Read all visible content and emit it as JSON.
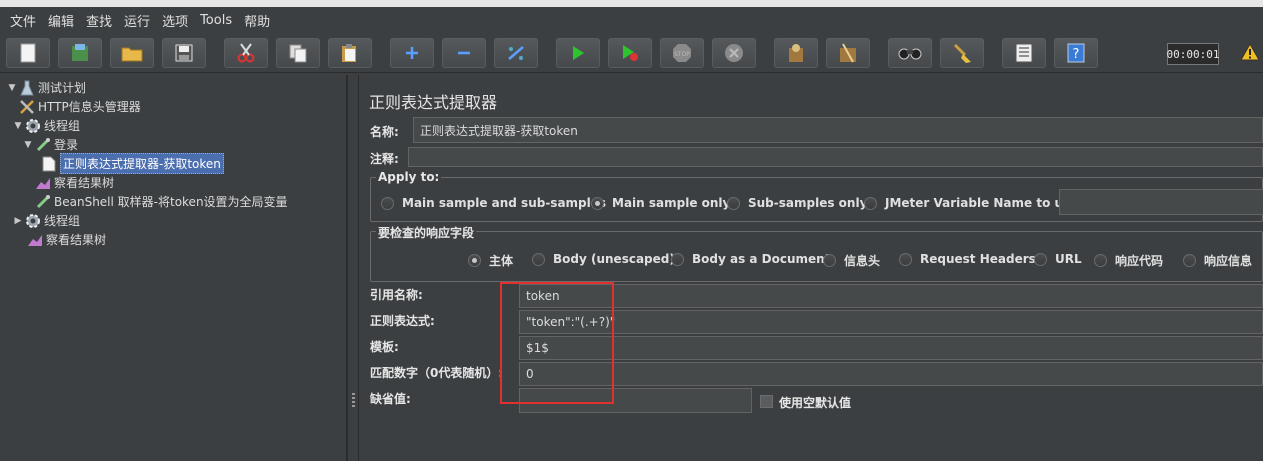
{
  "menu": [
    "文件",
    "编辑",
    "查找",
    "运行",
    "选项",
    "Tools",
    "帮助"
  ],
  "timer": "00:00:01",
  "toolbar_icons": [
    "new-icon",
    "template-icon",
    "open-icon",
    "save-icon",
    "cut-icon",
    "copy-icon",
    "paste-icon",
    "expand-icon",
    "collapse-icon",
    "toggle-icon",
    "start-icon",
    "start-no-pause-icon",
    "stop-icon",
    "shutdown-icon",
    "clear-icon",
    "clear-all-icon",
    "search-icon",
    "broom-icon",
    "function-helper-icon",
    "help-icon"
  ],
  "tree": [
    {
      "label": "测试计划",
      "icon": "flask-icon",
      "toggle": "▼"
    },
    {
      "label": "HTTP信息头管理器",
      "icon": "wrench-icon",
      "toggle": ""
    },
    {
      "label": "线程组",
      "icon": "gear-icon",
      "toggle": "▼"
    },
    {
      "label": "登录",
      "icon": "pipette-icon",
      "toggle": "▼"
    },
    {
      "label": "正则表达式提取器-获取token",
      "icon": "document-icon",
      "toggle": "",
      "selected": true
    },
    {
      "label": "察看结果树",
      "icon": "chart-icon",
      "toggle": ""
    },
    {
      "label": "BeanShell 取样器-将token设置为全局变量",
      "icon": "pipette-icon",
      "toggle": ""
    },
    {
      "label": "线程组",
      "icon": "gear-icon",
      "toggle": "▶"
    },
    {
      "label": "察看结果树",
      "icon": "chart-icon",
      "toggle": ""
    }
  ],
  "panel": {
    "title": "正则表达式提取器",
    "name_label": "名称:",
    "name_value": "正则表达式提取器-获取token",
    "comment_label": "注释:",
    "comment_value": "",
    "apply_to": {
      "title": "Apply to:",
      "options": [
        "Main sample and sub-samples",
        "Main sample only",
        "Sub-samples only",
        "JMeter Variable Name to use"
      ],
      "selected": "Main sample only"
    },
    "response_field": {
      "title": "要检查的响应字段",
      "options": [
        "主体",
        "Body (unescaped)",
        "Body as a Document",
        "信息头",
        "Request Headers",
        "URL",
        "响应代码",
        "响应信息"
      ],
      "selected": "主体"
    },
    "ref_name_label": "引用名称:",
    "ref_name_value": "token",
    "regex_label": "正则表达式:",
    "regex_value": "\"token\":\"(.+?)\"",
    "template_label": "模板:",
    "template_value": "$1$",
    "match_no_label": "匹配数字（0代表随机）:",
    "match_no_value": "0",
    "default_label": "缺省值:",
    "default_value": "",
    "use_empty_label": "使用空默认值"
  }
}
